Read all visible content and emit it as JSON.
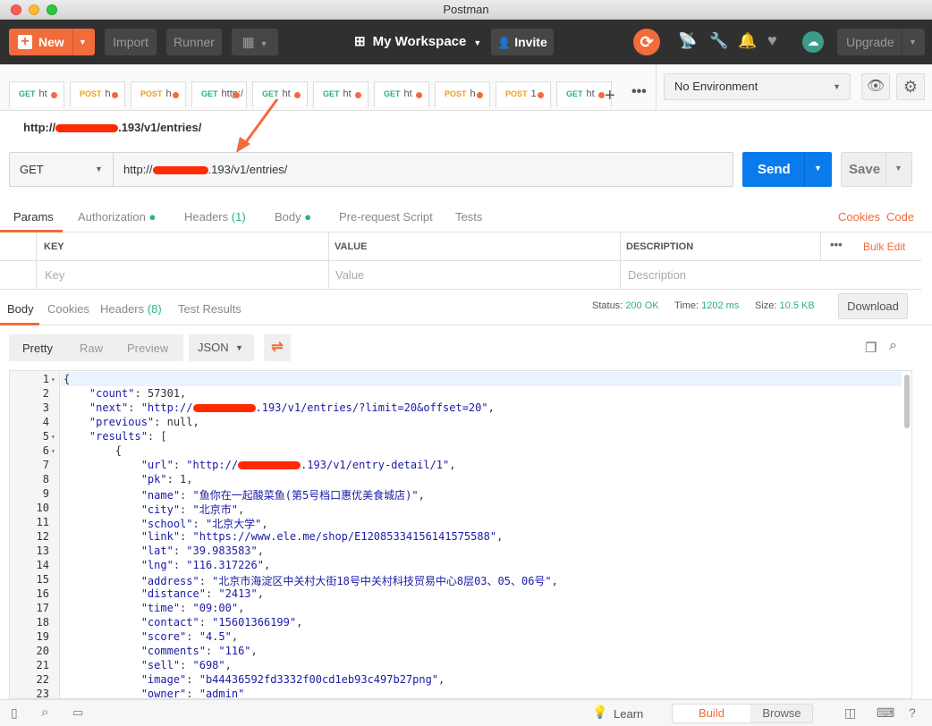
{
  "window": {
    "title": "Postman"
  },
  "toolbar": {
    "new_label": "New",
    "import_label": "Import",
    "runner_label": "Runner",
    "workspace_label": "My Workspace",
    "invite_label": "Invite",
    "upgrade_label": "Upgrade"
  },
  "tabs": [
    {
      "method": "GET",
      "name": "ht",
      "color": "#26b47f"
    },
    {
      "method": "POST",
      "name": "h",
      "color": "#f39c12"
    },
    {
      "method": "POST",
      "name": "h",
      "color": "#f39c12"
    },
    {
      "method": "GET",
      "name": "http:/",
      "color": "#26b47f"
    },
    {
      "method": "GET",
      "name": "ht",
      "color": "#26b47f"
    },
    {
      "method": "GET",
      "name": "ht",
      "color": "#26b47f"
    },
    {
      "method": "GET",
      "name": "ht",
      "color": "#26b47f"
    },
    {
      "method": "POST",
      "name": "h",
      "color": "#f39c12"
    },
    {
      "method": "POST",
      "name": "1",
      "color": "#f39c12"
    },
    {
      "method": "GET",
      "name": "ht",
      "color": "#26b47f"
    }
  ],
  "environment": {
    "selected": "No Environment"
  },
  "request": {
    "title_prefix": "http://",
    "title_suffix": ".193/v1/entries/",
    "method": "GET",
    "url_prefix": "http://",
    "url_suffix": ".193/v1/entries/",
    "send_label": "Send",
    "save_label": "Save"
  },
  "req_tabs": {
    "params": "Params",
    "authorization": "Authorization",
    "headers": "Headers",
    "headers_count": "(1)",
    "body": "Body",
    "prerequest": "Pre-request Script",
    "tests": "Tests",
    "cookies": "Cookies",
    "code": "Code"
  },
  "params_table": {
    "key_header": "KEY",
    "value_header": "VALUE",
    "desc_header": "DESCRIPTION",
    "bulk_edit": "Bulk Edit",
    "key_placeholder": "Key",
    "value_placeholder": "Value",
    "desc_placeholder": "Description"
  },
  "response": {
    "tabs": {
      "body": "Body",
      "cookies": "Cookies",
      "headers": "Headers",
      "headers_count": "(8)",
      "test_results": "Test Results"
    },
    "status_label": "Status:",
    "status_value": "200 OK",
    "time_label": "Time:",
    "time_value": "1202 ms",
    "size_label": "Size:",
    "size_value": "10.5 KB",
    "download_label": "Download",
    "view": {
      "pretty": "Pretty",
      "raw": "Raw",
      "preview": "Preview",
      "format": "JSON"
    }
  },
  "code_lines": [
    {
      "n": "1",
      "fold": true,
      "parts": [
        {
          "t": "{",
          "c": "p"
        }
      ]
    },
    {
      "n": "2",
      "parts": [
        {
          "t": "    \"count\"",
          "c": "k"
        },
        {
          "t": ": 57301,",
          "c": "p"
        }
      ]
    },
    {
      "n": "3",
      "parts": [
        {
          "t": "    \"next\"",
          "c": "k"
        },
        {
          "t": ": ",
          "c": "p"
        },
        {
          "t": "\"http://",
          "c": "s"
        },
        {
          "t": "R",
          "c": "r",
          "w": 70
        },
        {
          "t": ".193/v1/entries/?limit=20&offset=20\"",
          "c": "s"
        },
        {
          "t": ",",
          "c": "p"
        }
      ]
    },
    {
      "n": "4",
      "parts": [
        {
          "t": "    \"previous\"",
          "c": "k"
        },
        {
          "t": ": null,",
          "c": "p"
        }
      ]
    },
    {
      "n": "5",
      "fold": true,
      "parts": [
        {
          "t": "    \"results\"",
          "c": "k"
        },
        {
          "t": ": [",
          "c": "p"
        }
      ]
    },
    {
      "n": "6",
      "fold": true,
      "parts": [
        {
          "t": "        {",
          "c": "p"
        }
      ]
    },
    {
      "n": "7",
      "parts": [
        {
          "t": "            \"url\"",
          "c": "k"
        },
        {
          "t": ": ",
          "c": "p"
        },
        {
          "t": "\"http://",
          "c": "s"
        },
        {
          "t": "R",
          "c": "r",
          "w": 70
        },
        {
          "t": ".193/v1/entry-detail/1\"",
          "c": "s"
        },
        {
          "t": ",",
          "c": "p"
        }
      ]
    },
    {
      "n": "8",
      "parts": [
        {
          "t": "            \"pk\"",
          "c": "k"
        },
        {
          "t": ": 1,",
          "c": "p"
        }
      ]
    },
    {
      "n": "9",
      "parts": [
        {
          "t": "            \"name\"",
          "c": "k"
        },
        {
          "t": ": ",
          "c": "p"
        },
        {
          "t": "\"鱼你在一起酸菜鱼(第5号档口惠优美食城店)\"",
          "c": "s"
        },
        {
          "t": ",",
          "c": "p"
        }
      ]
    },
    {
      "n": "10",
      "parts": [
        {
          "t": "            \"city\"",
          "c": "k"
        },
        {
          "t": ": ",
          "c": "p"
        },
        {
          "t": "\"北京市\"",
          "c": "s"
        },
        {
          "t": ",",
          "c": "p"
        }
      ]
    },
    {
      "n": "11",
      "parts": [
        {
          "t": "            \"school\"",
          "c": "k"
        },
        {
          "t": ": ",
          "c": "p"
        },
        {
          "t": "\"北京大学\"",
          "c": "s"
        },
        {
          "t": ",",
          "c": "p"
        }
      ]
    },
    {
      "n": "12",
      "parts": [
        {
          "t": "            \"link\"",
          "c": "k"
        },
        {
          "t": ": ",
          "c": "p"
        },
        {
          "t": "\"https://www.ele.me/shop/E12085334156141575588\"",
          "c": "s"
        },
        {
          "t": ",",
          "c": "p"
        }
      ]
    },
    {
      "n": "13",
      "parts": [
        {
          "t": "            \"lat\"",
          "c": "k"
        },
        {
          "t": ": ",
          "c": "p"
        },
        {
          "t": "\"39.983583\"",
          "c": "s"
        },
        {
          "t": ",",
          "c": "p"
        }
      ]
    },
    {
      "n": "14",
      "parts": [
        {
          "t": "            \"lng\"",
          "c": "k"
        },
        {
          "t": ": ",
          "c": "p"
        },
        {
          "t": "\"116.317226\"",
          "c": "s"
        },
        {
          "t": ",",
          "c": "p"
        }
      ]
    },
    {
      "n": "15",
      "parts": [
        {
          "t": "            \"address\"",
          "c": "k"
        },
        {
          "t": ": ",
          "c": "p"
        },
        {
          "t": "\"北京市海淀区中关村大街18号中关村科技贸易中心8层03、05、06号\"",
          "c": "s"
        },
        {
          "t": ",",
          "c": "p"
        }
      ]
    },
    {
      "n": "16",
      "parts": [
        {
          "t": "            \"distance\"",
          "c": "k"
        },
        {
          "t": ": ",
          "c": "p"
        },
        {
          "t": "\"2413\"",
          "c": "s"
        },
        {
          "t": ",",
          "c": "p"
        }
      ]
    },
    {
      "n": "17",
      "parts": [
        {
          "t": "            \"time\"",
          "c": "k"
        },
        {
          "t": ": ",
          "c": "p"
        },
        {
          "t": "\"09:00\"",
          "c": "s"
        },
        {
          "t": ",",
          "c": "p"
        }
      ]
    },
    {
      "n": "18",
      "parts": [
        {
          "t": "            \"contact\"",
          "c": "k"
        },
        {
          "t": ": ",
          "c": "p"
        },
        {
          "t": "\"15601366199\"",
          "c": "s"
        },
        {
          "t": ",",
          "c": "p"
        }
      ]
    },
    {
      "n": "19",
      "parts": [
        {
          "t": "            \"score\"",
          "c": "k"
        },
        {
          "t": ": ",
          "c": "p"
        },
        {
          "t": "\"4.5\"",
          "c": "s"
        },
        {
          "t": ",",
          "c": "p"
        }
      ]
    },
    {
      "n": "20",
      "parts": [
        {
          "t": "            \"comments\"",
          "c": "k"
        },
        {
          "t": ": ",
          "c": "p"
        },
        {
          "t": "\"116\"",
          "c": "s"
        },
        {
          "t": ",",
          "c": "p"
        }
      ]
    },
    {
      "n": "21",
      "parts": [
        {
          "t": "            \"sell\"",
          "c": "k"
        },
        {
          "t": ": ",
          "c": "p"
        },
        {
          "t": "\"698\"",
          "c": "s"
        },
        {
          "t": ",",
          "c": "p"
        }
      ]
    },
    {
      "n": "22",
      "parts": [
        {
          "t": "            \"image\"",
          "c": "k"
        },
        {
          "t": ": ",
          "c": "p"
        },
        {
          "t": "\"b44436592fd3332f00cd1eb93c497b27png\"",
          "c": "s"
        },
        {
          "t": ",",
          "c": "p"
        }
      ]
    },
    {
      "n": "23",
      "parts": [
        {
          "t": "            \"owner\"",
          "c": "k"
        },
        {
          "t": ": ",
          "c": "p"
        },
        {
          "t": "\"admin\"",
          "c": "s"
        }
      ]
    }
  ],
  "statusbar": {
    "learn": "Learn",
    "build": "Build",
    "browse": "Browse"
  },
  "colors": {
    "accent": "#f26b3a",
    "primary": "#097bed",
    "success": "#26b47f",
    "warning": "#f39c12",
    "dark": "#303030"
  }
}
